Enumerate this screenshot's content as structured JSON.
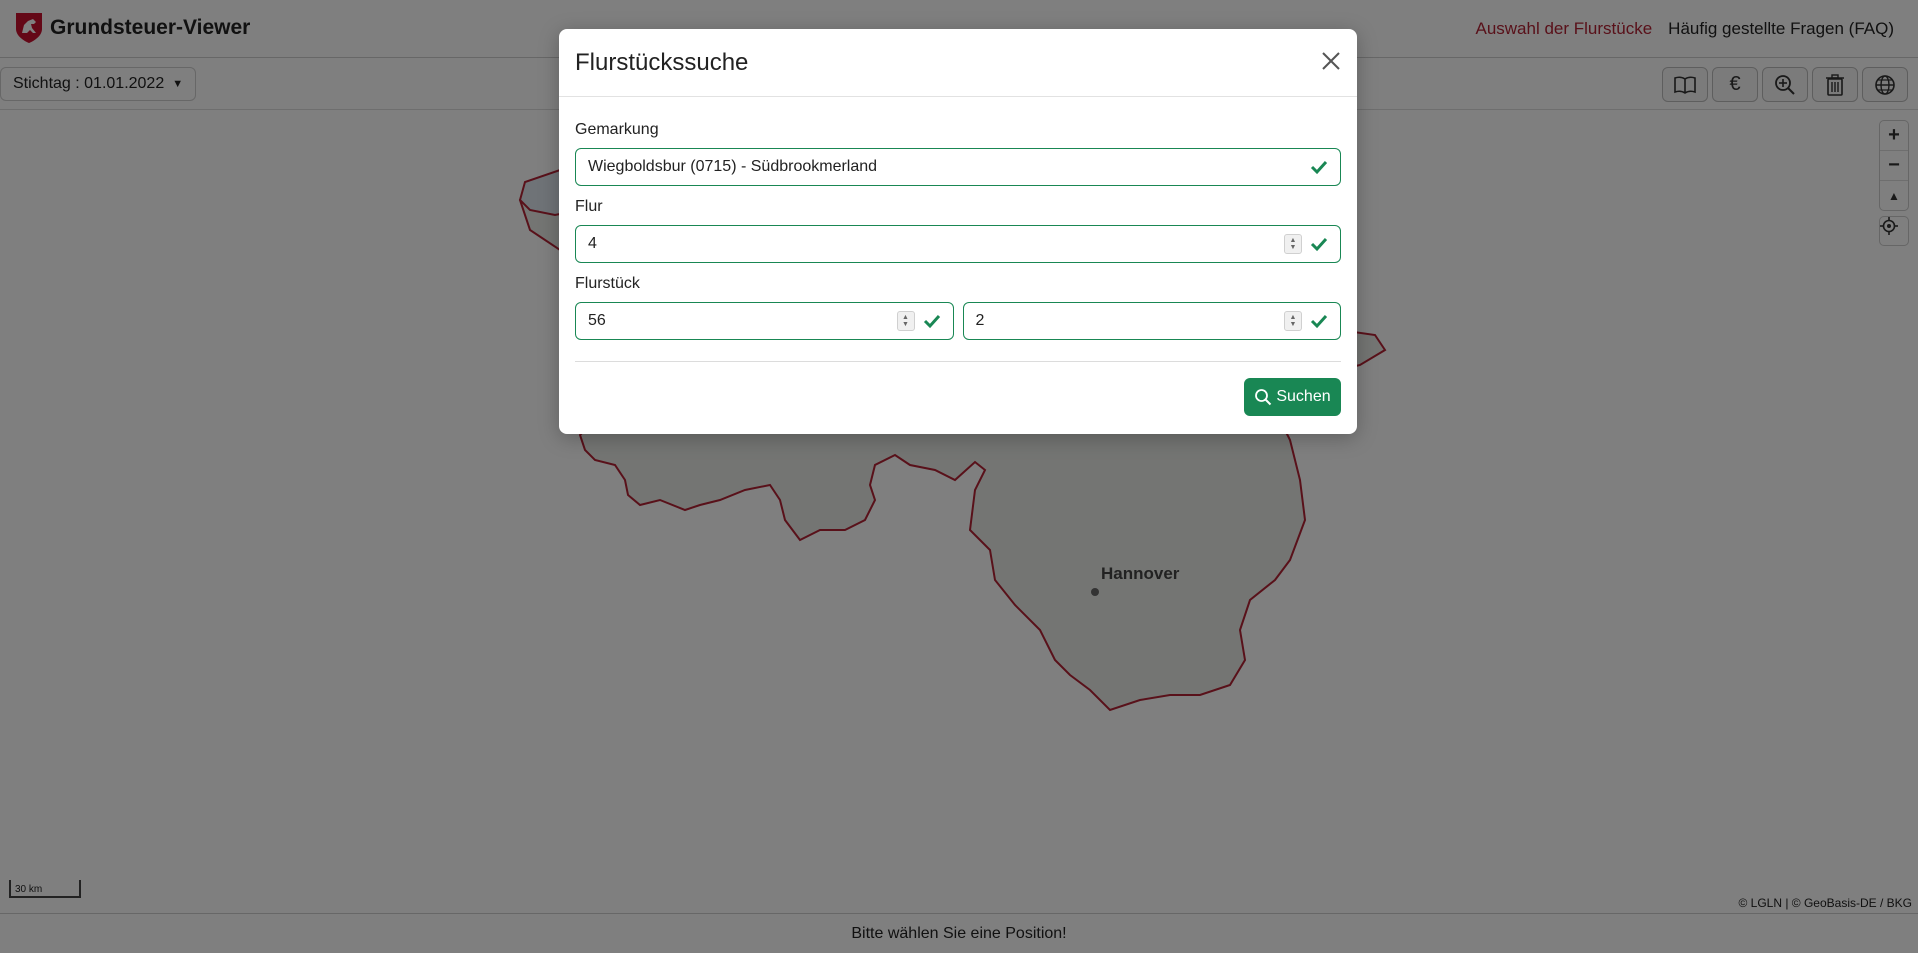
{
  "header": {
    "app_title": "Grundsteuer-Viewer",
    "nav": {
      "parcel_selection": "Auswahl der Flurstücke",
      "faq": "Häufig gestellte Fragen (FAQ)"
    }
  },
  "toolbar": {
    "date_label": "Stichtag : 01.01.2022",
    "tools": [
      "book-icon",
      "euro-icon",
      "zoom-in-icon",
      "trash-icon",
      "globe-icon"
    ],
    "euro_symbol": "€"
  },
  "map": {
    "city_label": "Hannover",
    "scale_label": "30 km",
    "attribution": "© LGLN | © GeoBasis-DE / BKG",
    "zoom_in": "+",
    "zoom_out": "−",
    "reset_north": "▲"
  },
  "footer": {
    "status": "Bitte wählen Sie eine Position!"
  },
  "modal": {
    "title": "Flurstückssuche",
    "gemarkung_label": "Gemarkung",
    "gemarkung_value": "Wiegboldsbur (0715) - Südbrookmerland",
    "flur_label": "Flur",
    "flur_value": "4",
    "flurstueck_label": "Flurstück",
    "zaehler_value": "56",
    "nenner_value": "2",
    "search_button": "Suchen"
  },
  "colors": {
    "accent_green": "#198754",
    "nav_active": "#b22234",
    "border_outline": "#b22234"
  }
}
